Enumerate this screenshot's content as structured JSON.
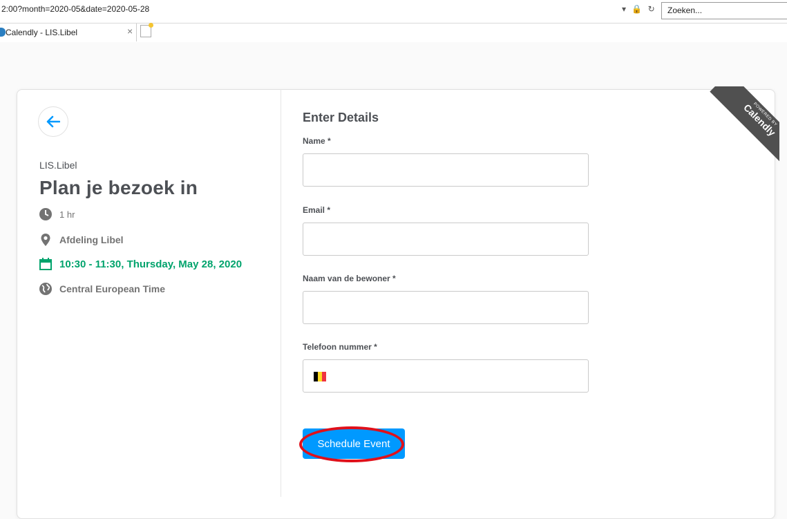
{
  "browser": {
    "url": "2:00?month=2020-05&date=2020-05-28",
    "search_placeholder": "Zoeken...",
    "tab_title": "Calendly - LIS.Libel",
    "tab_close": "×",
    "url_icons": [
      "▾",
      "🔒",
      "↻"
    ]
  },
  "event": {
    "organization": "LIS.Libel",
    "title": "Plan je bezoek in",
    "duration": "1 hr",
    "location": "Afdeling Libel",
    "datetime": "10:30 - 11:30, Thursday, May 28, 2020",
    "timezone": "Central European Time"
  },
  "form": {
    "title": "Enter Details",
    "fields": [
      {
        "label": "Name *",
        "value": ""
      },
      {
        "label": "Email *",
        "value": ""
      },
      {
        "label": "Naam van de bewoner *",
        "value": ""
      },
      {
        "label": "Telefoon nummer *",
        "value": ""
      }
    ],
    "submit_label": "Schedule Event"
  },
  "badge": {
    "line1": "POWERED BY",
    "line2": "Calendly"
  },
  "colors": {
    "accent": "#0099ff",
    "green": "#00a36c",
    "annotation": "#e0101a"
  },
  "icons": {
    "back": "arrow-left-icon",
    "duration": "clock-icon",
    "location": "map-pin-icon",
    "date": "calendar-icon",
    "timezone": "globe-icon",
    "flag": "belgium-flag-icon"
  }
}
